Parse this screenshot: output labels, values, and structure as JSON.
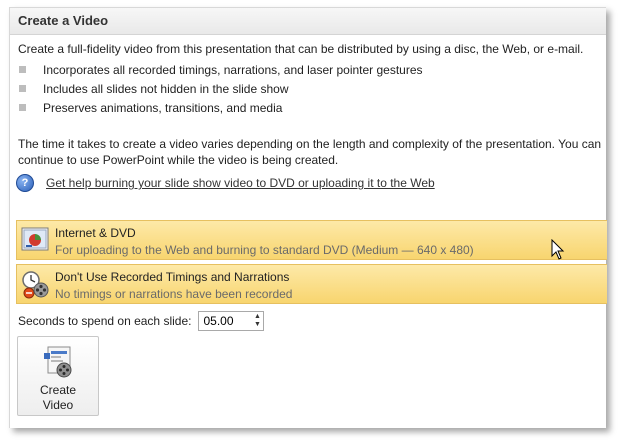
{
  "header": {
    "title": "Create a Video"
  },
  "description": "Create a full-fidelity video from this presentation that can be distributed by using a disc, the Web, or e-mail.",
  "bullets": [
    "Incorporates all recorded timings, narrations, and laser pointer gestures",
    "Includes all slides not hidden in the slide show",
    "Preserves animations, transitions, and media"
  ],
  "timing_note": "The time it takes to create a video varies depending on the length and complexity of the presentation. You can continue to use PowerPoint while the video is being created.",
  "help_link": "Get help burning your slide show video to DVD or uploading it to the Web",
  "options": [
    {
      "title": "Internet & DVD",
      "subtitle": "For uploading to the Web and burning to standard DVD  (Medium — 640 x 480)",
      "icon": "monitor-icon"
    },
    {
      "title": "Don't Use Recorded Timings and Narrations",
      "subtitle": "No timings or narrations have been recorded",
      "icon": "timing-film-icon"
    }
  ],
  "seconds": {
    "label": "Seconds to spend on each slide:",
    "value": "05.00"
  },
  "create_button": {
    "line1": "Create",
    "line2": "Video"
  },
  "colors": {
    "option_bg": "#f8d56f",
    "option_border": "#e6c060",
    "link": "#333333"
  }
}
